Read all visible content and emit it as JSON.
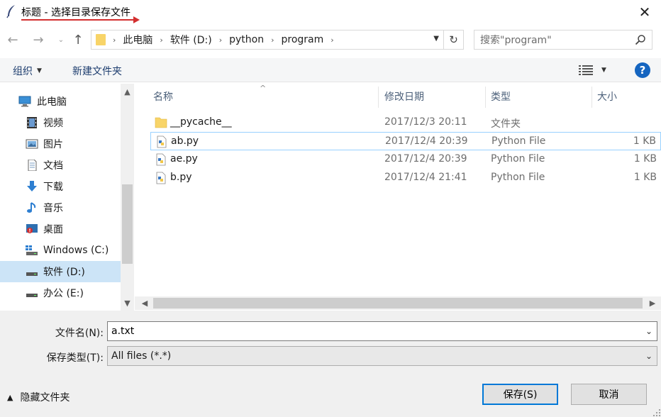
{
  "window": {
    "title": "标题 - 选择目录保存文件",
    "close_label": "✕"
  },
  "nav": {
    "back": "←",
    "forward": "→",
    "recent": "⌄",
    "up": "↑",
    "path": [
      "此电脑",
      "软件 (D:)",
      "python",
      "program"
    ],
    "refresh": "↻",
    "search_placeholder": "搜索\"program\""
  },
  "toolbar": {
    "organize": "组织",
    "new_folder": "新建文件夹",
    "help": "?"
  },
  "sidebar": {
    "items": [
      {
        "label": "此电脑",
        "icon": "computer-icon",
        "selected": false
      },
      {
        "label": "视频",
        "icon": "video-icon",
        "selected": false
      },
      {
        "label": "图片",
        "icon": "pictures-icon",
        "selected": false
      },
      {
        "label": "文档",
        "icon": "documents-icon",
        "selected": false
      },
      {
        "label": "下载",
        "icon": "download-icon",
        "selected": false
      },
      {
        "label": "音乐",
        "icon": "music-icon",
        "selected": false
      },
      {
        "label": "桌面",
        "icon": "desktop-icon",
        "selected": false
      },
      {
        "label": "Windows (C:)",
        "icon": "drive-icon",
        "selected": false
      },
      {
        "label": "软件 (D:)",
        "icon": "drive-icon",
        "selected": true
      },
      {
        "label": "办公 (E:)",
        "icon": "drive-icon",
        "selected": false
      }
    ]
  },
  "columns": {
    "name": "名称",
    "date": "修改日期",
    "type": "类型",
    "size": "大小"
  },
  "files": [
    {
      "name": "__pycache__",
      "date": "2017/12/3 20:11",
      "type": "文件夹",
      "size": "",
      "kind": "folder"
    },
    {
      "name": "ab.py",
      "date": "2017/12/4 20:39",
      "type": "Python File",
      "size": "1 KB",
      "kind": "python"
    },
    {
      "name": "ae.py",
      "date": "2017/12/4 20:39",
      "type": "Python File",
      "size": "1 KB",
      "kind": "python"
    },
    {
      "name": "b.py",
      "date": "2017/12/4 21:41",
      "type": "Python File",
      "size": "1 KB",
      "kind": "python"
    }
  ],
  "form": {
    "filename_label": "文件名(N):",
    "filename_value": "a.txt",
    "filetype_label": "保存类型(T):",
    "filetype_value": "All files (*.*)",
    "hide_folders": "隐藏文件夹",
    "save": "保存(S)",
    "cancel": "取消"
  },
  "colors": {
    "accent": "#0078d7",
    "selection": "#cce4f7",
    "annotation_red": "#d32f2f"
  }
}
